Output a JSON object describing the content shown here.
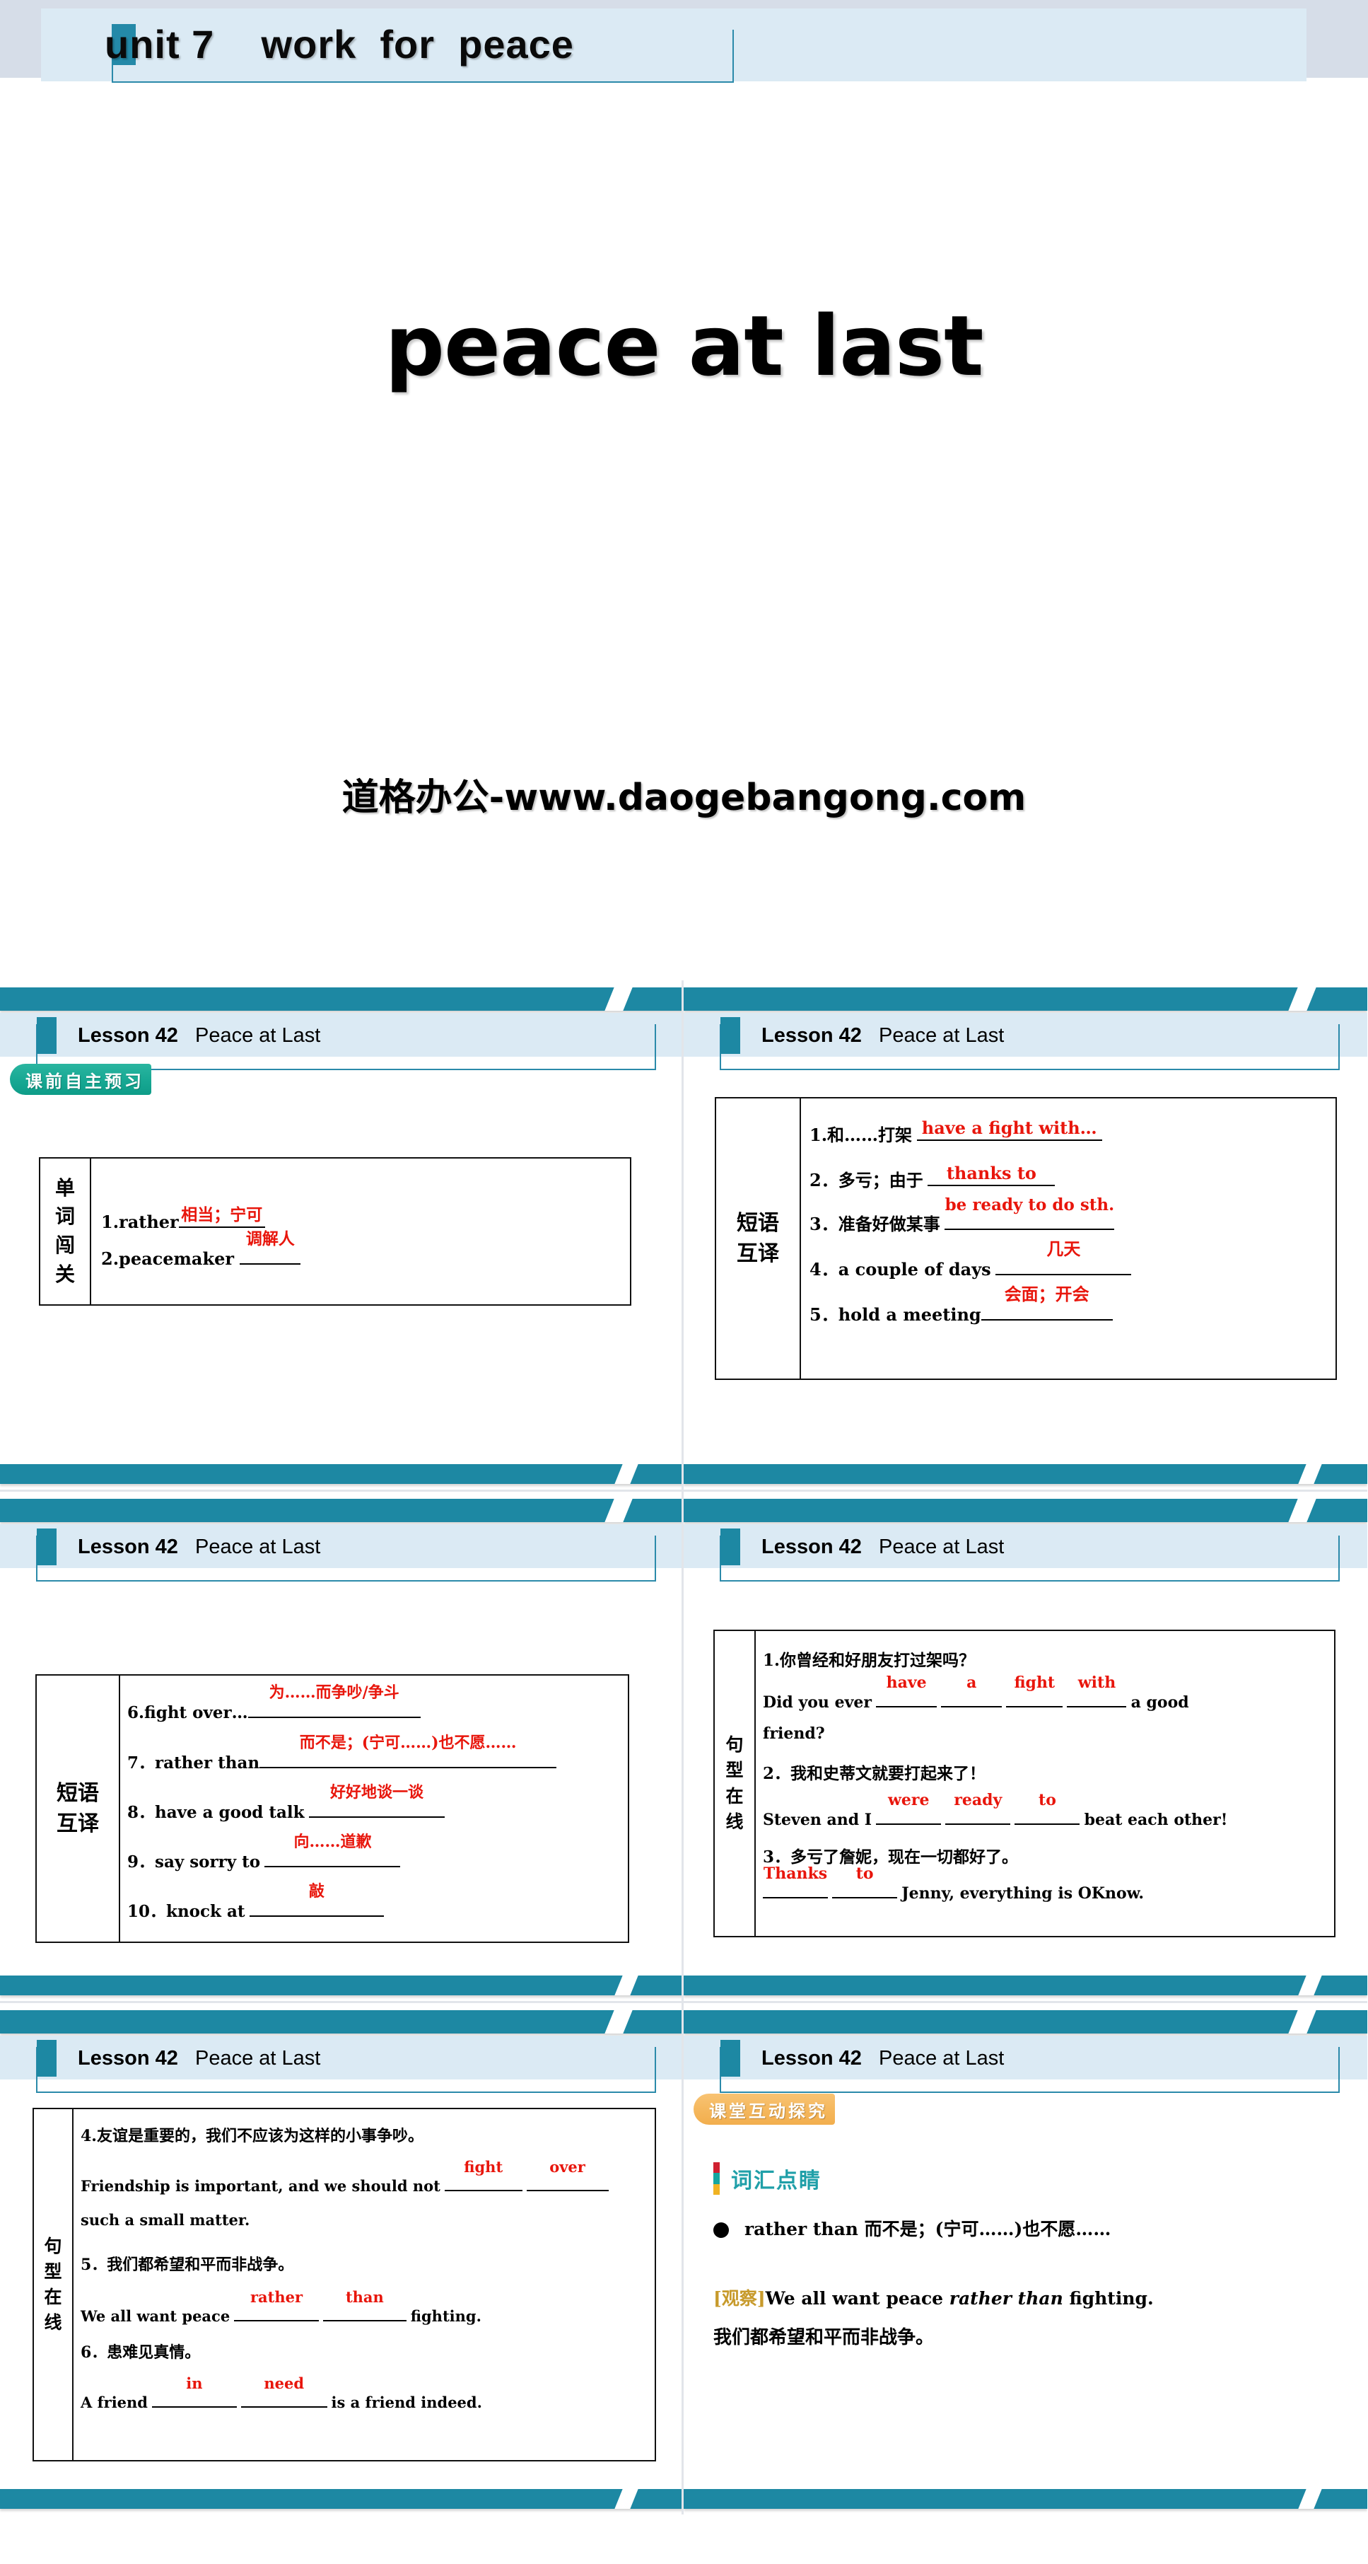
{
  "cover": {
    "unit_title": "unit 7    work  for  peace",
    "main_title": "peace at last",
    "watermark": "道格办公-www.daogebangong.com"
  },
  "slides": [
    {
      "header": {
        "lesson": "Lesson 42",
        "topic": "Peace at Last"
      },
      "badge": {
        "label": "课前自主预习",
        "color": "#17a893"
      },
      "table": {
        "label": "单\n词\n闯\n关",
        "rows": [
          {
            "prompt": "1.rather",
            "answer": "相当；宁可"
          },
          {
            "prompt": "2.peacemaker",
            "answer": "调解人"
          }
        ]
      }
    },
    {
      "header": {
        "lesson": "Lesson 42",
        "topic": "Peace at Last"
      },
      "table": {
        "label": "短语\n互译",
        "rows": [
          {
            "prompt": "1.和……打架",
            "answer": "have a fight with…"
          },
          {
            "prompt": "2．多亏；由于",
            "answer": "thanks to"
          },
          {
            "prompt": "3．准备好做某事",
            "answer": "be ready to do sth."
          },
          {
            "prompt": "4．a couple of days",
            "answer": "几天"
          },
          {
            "prompt": "5．hold a meeting",
            "answer": "会面；开会"
          }
        ]
      }
    },
    {
      "header": {
        "lesson": "Lesson 42",
        "topic": "Peace at Last"
      },
      "table": {
        "label": "短语\n互译",
        "rows": [
          {
            "prompt": "6.fight over…",
            "answer": "为……而争吵/争斗"
          },
          {
            "prompt": "7．rather than",
            "answer": "而不是；(宁可……)也不愿……"
          },
          {
            "prompt": "8．have a good talk",
            "answer": "好好地谈一谈"
          },
          {
            "prompt": "9．say sorry to",
            "answer": "向……道歉"
          },
          {
            "prompt": "10．knock at",
            "answer": "敲"
          }
        ]
      }
    },
    {
      "header": {
        "lesson": "Lesson 42",
        "topic": "Peace at Last"
      },
      "table": {
        "label": "句\n型\n在\n线",
        "items": [
          {
            "cn": "1.你曾经和好朋友打过架吗？",
            "en_before": "Did you ever",
            "answers": [
              "have",
              "a",
              "fight",
              "with"
            ],
            "en_after": "a good",
            "en_line2": "friend?"
          },
          {
            "cn": "2．我和史蒂文就要打起来了！",
            "en_before": "Steven and I",
            "answers": [
              "were",
              "ready",
              "to"
            ],
            "en_after": "beat each other!"
          },
          {
            "cn": "3．多亏了詹妮，现在一切都好了。",
            "answers": [
              "Thanks",
              "to"
            ],
            "en_after": "Jenny, everything is OKnow."
          }
        ]
      }
    },
    {
      "header": {
        "lesson": "Lesson 42",
        "topic": "Peace at Last"
      },
      "table": {
        "label": "句\n型\n在\n线",
        "items": [
          {
            "cn": "4.友谊是重要的，我们不应该为这样的小事争吵。",
            "en_before": "Friendship is important, and we should not",
            "answers": [
              "fight",
              "over"
            ],
            "en_line2": "such a small matter."
          },
          {
            "cn": "5．我们都希望和平而非战争。",
            "en_before": "We all want peace",
            "answers": [
              "rather",
              "than"
            ],
            "en_after": "fighting."
          },
          {
            "cn": "6．患难见真情。",
            "en_before": "A friend",
            "answers": [
              "in",
              "need"
            ],
            "en_after": "is a friend indeed."
          }
        ]
      }
    },
    {
      "header": {
        "lesson": "Lesson 42",
        "topic": "Peace at Last"
      },
      "badge": {
        "label": "课堂互动探究",
        "color": "#f5b75c"
      },
      "vocab": {
        "section_title": "词汇点睛",
        "entry": "rather than 而不是；(宁可……)也不愿……",
        "observe_tag": "[观察]",
        "example_before": "We all want peace ",
        "example_italic": "rather than",
        "example_after": " fighting.",
        "translation": "我们都希望和平而非战争。"
      }
    }
  ]
}
